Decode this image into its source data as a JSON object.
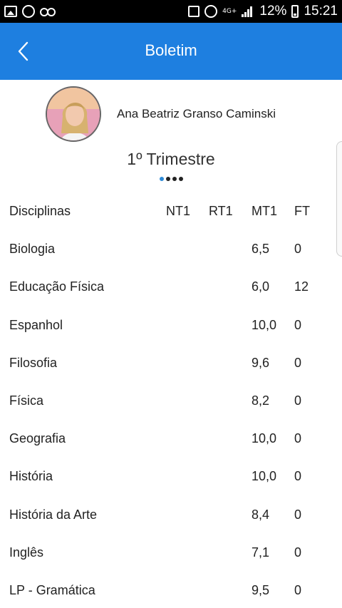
{
  "status_bar": {
    "network": "4G+",
    "battery": "12%",
    "time": "15:21"
  },
  "app_bar": {
    "title": "Boletim"
  },
  "profile": {
    "name": "Ana Beatriz Granso Caminski"
  },
  "period": {
    "label": "1º Trimestre",
    "page_count": 4,
    "active_page": 1
  },
  "table": {
    "headers": [
      "Disciplinas",
      "NT1",
      "RT1",
      "MT1",
      "FT"
    ],
    "rows": [
      {
        "subject": "Biologia",
        "nt1": "",
        "rt1": "",
        "mt1": "6,5",
        "ft": "0"
      },
      {
        "subject": "Educação Física",
        "nt1": "",
        "rt1": "",
        "mt1": "6,0",
        "ft": "12"
      },
      {
        "subject": "Espanhol",
        "nt1": "",
        "rt1": "",
        "mt1": "10,0",
        "ft": "0"
      },
      {
        "subject": "Filosofia",
        "nt1": "",
        "rt1": "",
        "mt1": "9,6",
        "ft": "0"
      },
      {
        "subject": "Física",
        "nt1": "",
        "rt1": "",
        "mt1": "8,2",
        "ft": "0"
      },
      {
        "subject": "Geografia",
        "nt1": "",
        "rt1": "",
        "mt1": "10,0",
        "ft": "0"
      },
      {
        "subject": "História",
        "nt1": "",
        "rt1": "",
        "mt1": "10,0",
        "ft": "0"
      },
      {
        "subject": "História da Arte",
        "nt1": "",
        "rt1": "",
        "mt1": "8,4",
        "ft": "0"
      },
      {
        "subject": "Inglês",
        "nt1": "",
        "rt1": "",
        "mt1": "7,1",
        "ft": "0"
      },
      {
        "subject": "LP - Gramática",
        "nt1": "",
        "rt1": "",
        "mt1": "9,5",
        "ft": "0"
      }
    ]
  },
  "colors": {
    "app_bar": "#1e7fe0",
    "active_dot": "#2d8ad6"
  }
}
